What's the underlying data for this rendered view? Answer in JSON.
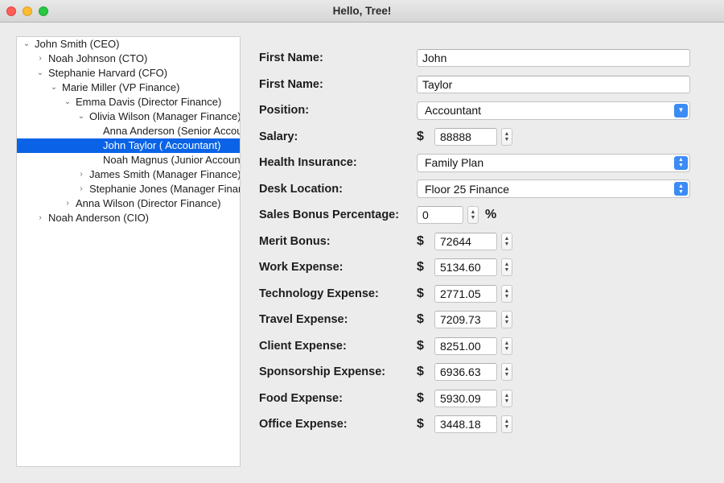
{
  "window": {
    "title": "Hello, Tree!",
    "traffic_lights": [
      "close-button",
      "minimize-button",
      "zoom-button"
    ],
    "accent_color": "#3b8cf5",
    "selection_color": "#0a63e6"
  },
  "tree": {
    "rows": [
      {
        "label": "John Smith (CEO)",
        "depth": 0,
        "disclosure": "expanded",
        "selected": false
      },
      {
        "label": "Noah Johnson (CTO)",
        "depth": 1,
        "disclosure": "collapsed",
        "selected": false
      },
      {
        "label": "Stephanie Harvard (CFO)",
        "depth": 1,
        "disclosure": "expanded",
        "selected": false
      },
      {
        "label": "Marie Miller (VP Finance)",
        "depth": 2,
        "disclosure": "expanded",
        "selected": false
      },
      {
        "label": "Emma Davis (Director Finance)",
        "depth": 3,
        "disclosure": "expanded",
        "selected": false
      },
      {
        "label": "Olivia Wilson (Manager Finance)",
        "depth": 4,
        "disclosure": "expanded",
        "selected": false
      },
      {
        "label": "Anna Anderson (Senior Accountant)",
        "depth": 5,
        "disclosure": "none",
        "selected": false
      },
      {
        "label": "John Taylor ( Accountant)",
        "depth": 5,
        "disclosure": "none",
        "selected": true
      },
      {
        "label": "Noah Magnus (Junior Accountant)",
        "depth": 5,
        "disclosure": "none",
        "selected": false
      },
      {
        "label": "James Smith (Manager Finance)",
        "depth": 4,
        "disclosure": "collapsed",
        "selected": false
      },
      {
        "label": "Stephanie Jones (Manager Finance)",
        "depth": 4,
        "disclosure": "collapsed",
        "selected": false
      },
      {
        "label": "Anna Wilson (Director Finance)",
        "depth": 3,
        "disclosure": "collapsed",
        "selected": false
      },
      {
        "label": "Noah Anderson (CIO)",
        "depth": 1,
        "disclosure": "collapsed",
        "selected": false
      }
    ]
  },
  "form": {
    "rows": [
      {
        "label": "First Name:",
        "type": "text",
        "value": "John"
      },
      {
        "label": "First Name:",
        "type": "text",
        "value": "Taylor"
      },
      {
        "label": "Position:",
        "type": "combo",
        "value": "Accountant"
      },
      {
        "label": "Salary:",
        "type": "money",
        "value": "88888",
        "prefix": "$"
      },
      {
        "label": "Health Insurance:",
        "type": "popup",
        "value": "Family Plan"
      },
      {
        "label": "Desk Location:",
        "type": "popup",
        "value": "Floor 25 Finance"
      },
      {
        "label": "Sales Bonus Percentage:",
        "type": "percent",
        "value": "0",
        "suffix": "%"
      },
      {
        "label": "Merit Bonus:",
        "type": "money",
        "value": "72644",
        "prefix": "$"
      },
      {
        "label": "Work Expense:",
        "type": "money",
        "value": "5134.60",
        "prefix": "$"
      },
      {
        "label": "Technology Expense:",
        "type": "money",
        "value": "2771.05",
        "prefix": "$"
      },
      {
        "label": "Travel Expense:",
        "type": "money",
        "value": "7209.73",
        "prefix": "$"
      },
      {
        "label": "Client Expense:",
        "type": "money",
        "value": "8251.00",
        "prefix": "$"
      },
      {
        "label": "Sponsorship Expense:",
        "type": "money",
        "value": "6936.63",
        "prefix": "$"
      },
      {
        "label": "Food Expense:",
        "type": "money",
        "value": "5930.09",
        "prefix": "$"
      },
      {
        "label": "Office Expense:",
        "type": "money",
        "value": "3448.18",
        "prefix": "$"
      }
    ]
  },
  "icons": {
    "disclosure_expanded": "⌄",
    "disclosure_collapsed": "›",
    "chevron_up": "▲",
    "chevron_down": "▼"
  }
}
